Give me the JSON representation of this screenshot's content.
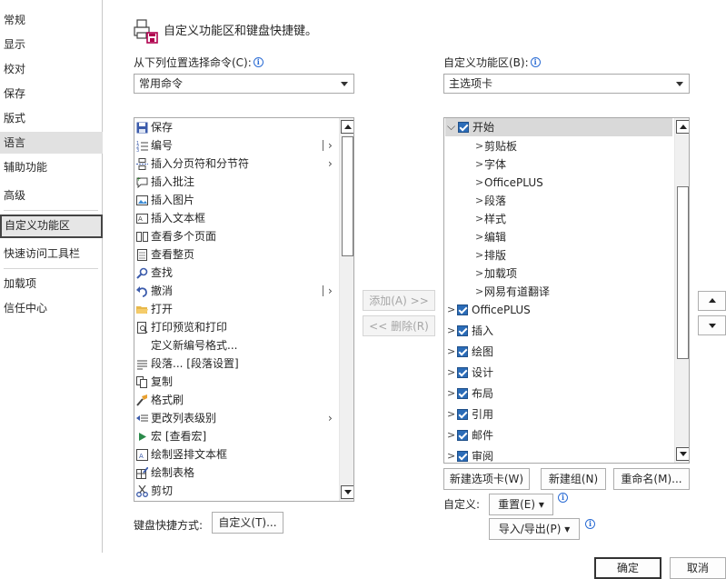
{
  "nav": {
    "items": [
      {
        "label": "常规"
      },
      {
        "label": "显示"
      },
      {
        "label": "校对"
      },
      {
        "label": "保存"
      },
      {
        "label": "版式"
      },
      {
        "label": "语言"
      },
      {
        "label": "辅助功能"
      },
      {
        "label": "高级"
      },
      {
        "label": "自定义功能区"
      },
      {
        "label": "快速访问工具栏"
      },
      {
        "label": "加载项"
      },
      {
        "label": "信任中心"
      }
    ]
  },
  "header": {
    "title": "自定义功能区和键盘快捷键。"
  },
  "left": {
    "label": "从下列位置选择命令(C):",
    "combo_value": "常用命令",
    "commands": [
      {
        "label": "保存",
        "icon": "save-icon"
      },
      {
        "label": "编号",
        "icon": "numbering-icon"
      },
      {
        "label": "插入分页符和分节符",
        "icon": "page-break-icon"
      },
      {
        "label": "插入批注",
        "icon": "comment-icon"
      },
      {
        "label": "插入图片",
        "icon": "picture-icon"
      },
      {
        "label": "插入文本框",
        "icon": "textbox-icon"
      },
      {
        "label": "查看多个页面",
        "icon": "multiple-pages-icon"
      },
      {
        "label": "查看整页",
        "icon": "one-page-icon"
      },
      {
        "label": "查找",
        "icon": "find-icon"
      },
      {
        "label": "撤消",
        "icon": "undo-icon"
      },
      {
        "label": "打开",
        "icon": "open-folder-icon"
      },
      {
        "label": "打印预览和打印",
        "icon": "print-preview-icon"
      },
      {
        "label": "定义新编号格式...",
        "icon": ""
      },
      {
        "label": "段落... [段落设置]",
        "icon": "paragraph-icon"
      },
      {
        "label": "复制",
        "icon": "copy-icon"
      },
      {
        "label": "格式刷",
        "icon": "format-painter-icon"
      },
      {
        "label": "更改列表级别",
        "icon": "list-level-icon"
      },
      {
        "label": "宏 [查看宏]",
        "icon": "macro-icon"
      },
      {
        "label": "绘制竖排文本框",
        "icon": "vertical-textbox-icon"
      },
      {
        "label": "绘制表格",
        "icon": "draw-table-icon"
      },
      {
        "label": "剪切",
        "icon": "cut-icon"
      }
    ]
  },
  "middle": {
    "add_label": "添加(A) >>",
    "remove_label": "<< 删除(R)"
  },
  "right": {
    "label": "自定义功能区(B):",
    "combo_value": "主选项卡",
    "tree": [
      {
        "label": "开始",
        "level": 0,
        "checked": true,
        "expanded": true
      },
      {
        "label": "剪贴板",
        "level": 1
      },
      {
        "label": "字体",
        "level": 1
      },
      {
        "label": "OfficePLUS",
        "level": 1
      },
      {
        "label": "段落",
        "level": 1
      },
      {
        "label": "样式",
        "level": 1
      },
      {
        "label": "编辑",
        "level": 1
      },
      {
        "label": "排版",
        "level": 1
      },
      {
        "label": "加载项",
        "level": 1
      },
      {
        "label": "网易有道翻译",
        "level": 1
      },
      {
        "label": "OfficePLUS",
        "level": 0,
        "checked": true
      },
      {
        "label": "插入",
        "level": 0,
        "checked": true
      },
      {
        "label": "绘图",
        "level": 0,
        "checked": true
      },
      {
        "label": "设计",
        "level": 0,
        "checked": true
      },
      {
        "label": "布局",
        "level": 0,
        "checked": true
      },
      {
        "label": "引用",
        "level": 0,
        "checked": true
      },
      {
        "label": "邮件",
        "level": 0,
        "checked": true
      },
      {
        "label": "审阅",
        "level": 0,
        "checked": true
      }
    ],
    "new_tab_label": "新建选项卡(W)",
    "new_group_label": "新建组(N)",
    "rename_label": "重命名(M)...",
    "customize_label": "自定义:",
    "reset_label": "重置(E) ▾",
    "import_export_label": "导入/导出(P) ▾"
  },
  "keyboard": {
    "label": "键盘快捷方式:",
    "button": "自定义(T)..."
  },
  "footer": {
    "ok_label": "确定",
    "cancel_label": "取消"
  },
  "colors": {
    "checkbox": "#2b6cb8",
    "selected_row": "#d9d9d9",
    "info": "#2b6cd4"
  }
}
